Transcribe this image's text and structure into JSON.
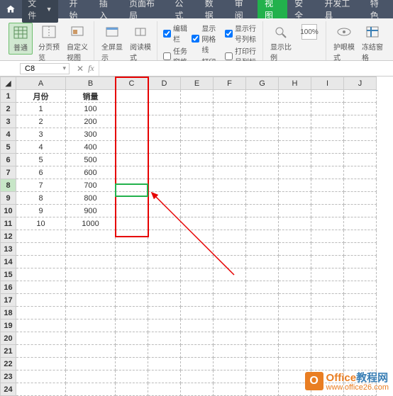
{
  "titlebar": {
    "file_label": "文件",
    "tabs": [
      "开始",
      "插入",
      "页面布局",
      "公式",
      "数据",
      "审阅",
      "视图",
      "安全",
      "开发工具",
      "特色"
    ],
    "active_index": 6
  },
  "ribbon": {
    "normal": "普通",
    "page_break": "分页预览",
    "custom_view": "自定义视图",
    "fullscreen": "全屏显示",
    "reading": "阅读模式",
    "chk_formula_bar": "编辑栏",
    "chk_task_pane": "任务窗格",
    "chk_gridlines": "显示网格线",
    "chk_print_grid": "打印网格线",
    "chk_headings": "显示行号列标",
    "chk_print_head": "打印行号列标",
    "zoom": "显示比例",
    "zoom_pct": "100%",
    "eyecare": "护眼模式",
    "freeze": "冻结窗格"
  },
  "formula_bar": {
    "cell_ref": "C8",
    "fx": "fx",
    "value": ""
  },
  "sheet": {
    "col_headers": [
      "A",
      "B",
      "C",
      "D",
      "E",
      "F",
      "G",
      "H",
      "I",
      "J"
    ],
    "row_count": 24,
    "headers": {
      "A": "月份",
      "B": "销量"
    },
    "rows": [
      {
        "A": "1",
        "B": "100"
      },
      {
        "A": "2",
        "B": "200"
      },
      {
        "A": "3",
        "B": "300"
      },
      {
        "A": "4",
        "B": "400"
      },
      {
        "A": "5",
        "B": "500"
      },
      {
        "A": "6",
        "B": "600"
      },
      {
        "A": "7",
        "B": "700"
      },
      {
        "A": "8",
        "B": "800"
      },
      {
        "A": "9",
        "B": "900"
      },
      {
        "A": "10",
        "B": "1000"
      }
    ],
    "selected_cell": "C8"
  },
  "watermark": {
    "brand1": "Office",
    "brand2": "教程网",
    "url": "www.office26.com"
  }
}
